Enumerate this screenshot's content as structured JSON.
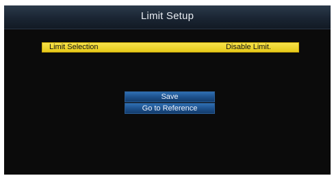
{
  "header": {
    "title": "Limit Setup"
  },
  "settings": {
    "rows": [
      {
        "label": "Limit Selection",
        "value": "Disable Limit."
      }
    ]
  },
  "actions": {
    "save_label": "Save",
    "goto_reference_label": "Go to Reference"
  },
  "colors": {
    "selection_highlight": "#e6c91a",
    "button_blue": "#1c4f8a",
    "background": "#0b0b0b"
  }
}
